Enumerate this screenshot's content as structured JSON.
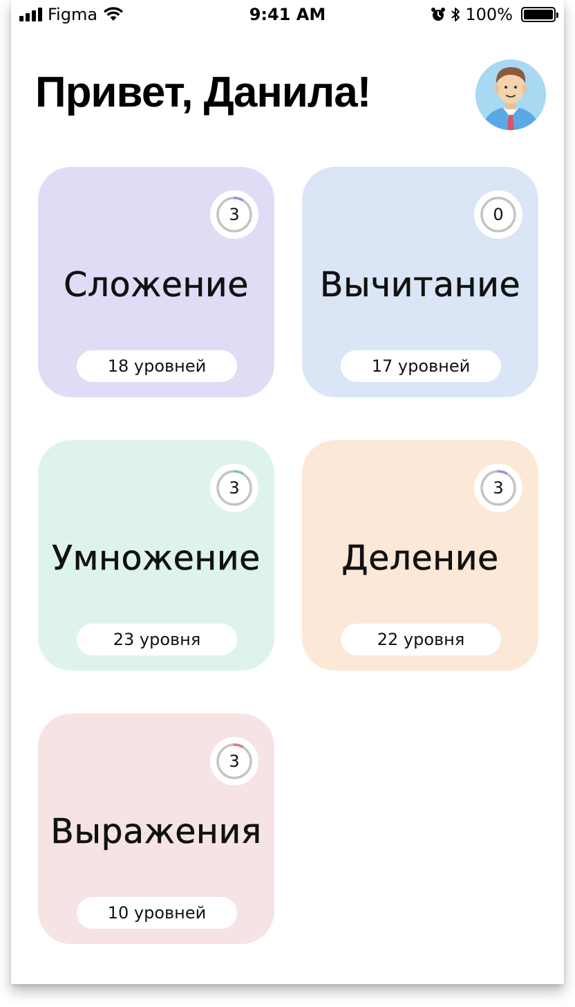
{
  "status_bar": {
    "carrier": "Figma",
    "time": "9:41 AM",
    "battery": "100%",
    "signal_icon": "signal-bars-icon",
    "wifi_icon": "wifi-icon",
    "alarm_icon": "alarm-icon",
    "bluetooth_icon": "bluetooth-icon",
    "battery_icon": "battery-icon"
  },
  "header": {
    "greeting": "Привет, Данила!",
    "avatar_icon": "user-avatar-icon"
  },
  "colors": {
    "addition": "#e2dbf6",
    "subtraction": "#dae6f6",
    "multiplication": "#dff3ee",
    "division": "#fbe8d6",
    "expressions": "#f6e4e4",
    "ring_track": "#c4c4c4",
    "ring_purple": "#9a8fe0",
    "ring_teal": "#79c8b5",
    "ring_red": "#e27a7a"
  },
  "cards": [
    {
      "key": "addition",
      "title": "Сложение",
      "levels_label": "18 уровней",
      "progress_value": "3",
      "progress_fraction": 0.08
    },
    {
      "key": "subtraction",
      "title": "Вычитание",
      "levels_label": "17 уровней",
      "progress_value": "0",
      "progress_fraction": 0
    },
    {
      "key": "multiplication",
      "title": "Умножение",
      "levels_label": "23 уровня",
      "progress_value": "3",
      "progress_fraction": 0.08
    },
    {
      "key": "division",
      "title": "Деление",
      "levels_label": "22 уровня",
      "progress_value": "3",
      "progress_fraction": 0.08
    },
    {
      "key": "expressions",
      "title": "Выражения",
      "levels_label": "10 уровней",
      "progress_value": "3",
      "progress_fraction": 0.08
    }
  ]
}
